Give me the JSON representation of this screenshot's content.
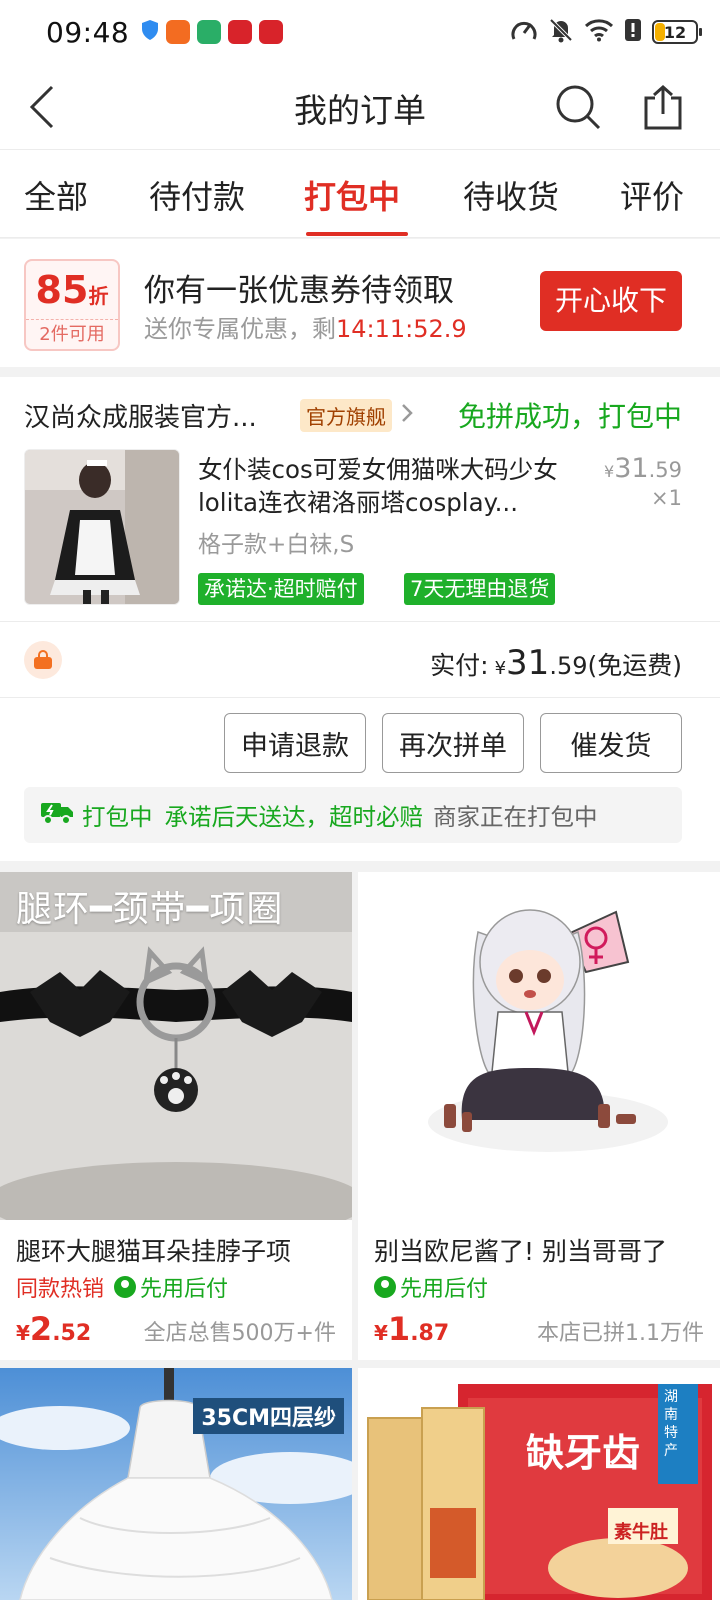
{
  "status_bar": {
    "time": "09:48",
    "battery": "12",
    "icons": [
      "shield-icon",
      "app-icon-orange",
      "wechat-icon",
      "app-icon-red",
      "app-icon-red-2",
      "speed-icon",
      "mute-icon",
      "wifi-icon",
      "alert-icon",
      "battery-icon"
    ]
  },
  "header": {
    "title": "我的订单",
    "back_icon": "back-arrow-icon",
    "search_icon": "search-icon",
    "share_icon": "share-icon"
  },
  "tabs": [
    {
      "label": "全部",
      "active": false
    },
    {
      "label": "待付款",
      "active": false
    },
    {
      "label": "打包中",
      "active": true
    },
    {
      "label": "待收货",
      "active": false
    },
    {
      "label": "评价",
      "active": false
    }
  ],
  "coupon": {
    "discount": "85",
    "discount_unit": "折",
    "usage": "2件可用",
    "headline": "你有一张优惠券待领取",
    "subtitle": "送你专属优惠，剩",
    "countdown": "14:11:52.9",
    "button": "开心收下"
  },
  "order": {
    "shop_name": "汉尚众成服装官方...",
    "shop_badge": "官方旗舰",
    "status": "免拼成功，打包中",
    "product_title": "女仆装cos可爱女佣猫咪大码少女lolita连衣裙洛丽塔cosplay...",
    "sku": "格子款+白袜,S",
    "tags": [
      "承诺达·超时赔付",
      "7天无理由退货"
    ],
    "price_symbol": "¥",
    "price_int": "31",
    "price_dec": ".59",
    "quantity": "×1",
    "pay_label": "实付:",
    "pay_symbol": "¥",
    "pay_int": "31",
    "pay_dec": ".59",
    "pay_note": "(免运费)",
    "buttons": [
      "申请退款",
      "再次拼单",
      "催发货"
    ],
    "shipping": {
      "status": "打包中",
      "promise": "承诺后天送达，超时必赔",
      "note": "商家正在打包中"
    }
  },
  "recommendations": [
    {
      "overlay_text": "腿环━颈带━项圈",
      "title": "腿环大腿猫耳朵挂脖子项",
      "hot_tag": "同款热销",
      "pay_later": "先用后付",
      "price_symbol": "¥",
      "price_int": "2",
      "price_dec": ".52",
      "sales": "全店总售500万+件"
    },
    {
      "title": "别当欧尼酱了! 别当哥哥了",
      "pay_later": "先用后付",
      "price_symbol": "¥",
      "price_int": "1",
      "price_dec": ".87",
      "sales": "本店已拼1.1万件"
    },
    {
      "overlay_text": "35CM四层纱"
    },
    {
      "brand_text": "缺牙齿",
      "flavor_text": "素牛肚",
      "region_text": "湖南特产"
    }
  ],
  "colors": {
    "accent": "#e02e24",
    "green": "#18a81f",
    "tag_green": "#1fb02b"
  }
}
